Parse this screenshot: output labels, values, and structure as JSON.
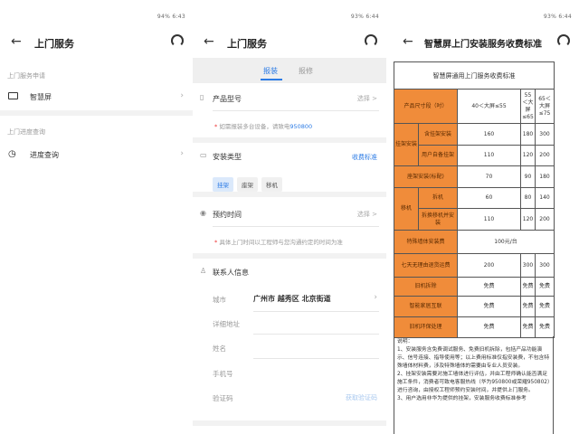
{
  "panel1": {
    "status": "94% 6:43",
    "title": "上门服务",
    "section1": "上门服务申请",
    "item1": "智慧屏",
    "section2": "上门进度查询",
    "item2": "进度查询"
  },
  "panel2": {
    "status": "93% 6:44",
    "title": "上门服务",
    "tabs": [
      "报装",
      "报修"
    ],
    "product": {
      "label": "产品型号",
      "action": "选择 >",
      "note_prefix": "* ",
      "note": "如需报装多台设备，请致电",
      "phone": "950800"
    },
    "install_type": {
      "label": "安装类型",
      "link": "收费标准",
      "chips": [
        "挂架",
        "座架",
        "移机"
      ]
    },
    "appointment": {
      "label": "预约时间",
      "action": "选择 >",
      "note_prefix": "* ",
      "note": "具体上门时间以工程师与您沟通约定的时间为准"
    },
    "contact": {
      "label": "联系人信息",
      "city_label": "城市",
      "city_value": "广州市 越秀区 北京街道",
      "address_label": "详细地址",
      "name_label": "姓名",
      "phone_label": "手机号",
      "code_label": "验证码",
      "code_button": "获取验证码"
    }
  },
  "panel3": {
    "status": "93% 6:44",
    "title": "智慧屏上门安装服务收费标准",
    "table": {
      "title": "智慧屏通用上门服务收费标准",
      "size_label": "产品尺寸段（吋）",
      "sizes": [
        "40＜大屏≤55",
        "55＜大屏≤65",
        "65＜大屏≤75"
      ],
      "wall_group": "挂架安装",
      "wall_rows": [
        {
          "label": "含挂架安装",
          "values": [
            "160",
            "180",
            "300"
          ]
        },
        {
          "label": "用户自备挂架",
          "values": [
            "110",
            "120",
            "200"
          ]
        }
      ],
      "stand": {
        "label": "座架安装(标配)",
        "values": [
          "70",
          "90",
          "180"
        ]
      },
      "move_group": "移机",
      "move_rows": [
        {
          "label": "拆机",
          "values": [
            "60",
            "80",
            "140"
          ]
        },
        {
          "label": "拆换移机并安装",
          "values": [
            "110",
            "120",
            "200"
          ]
        }
      ],
      "special": {
        "label": "特殊墙体安装费",
        "value": "100元/台"
      },
      "return": {
        "label": "七天无理由退货运费",
        "values": [
          "200",
          "300",
          "300"
        ]
      },
      "old_removal": {
        "label": "旧机拆除",
        "values": [
          "免费",
          "免费",
          "免费"
        ]
      },
      "smart_home": {
        "label": "智能家居互联",
        "values": [
          "免费",
          "免费",
          "免费"
        ]
      },
      "recycle": {
        "label": "旧机环保处理",
        "values": [
          "免费",
          "免费",
          "免费"
        ]
      }
    },
    "notes": [
      "说明：",
      "1、安装服务含免费调试服务、免费旧机拆除，包括产品功能演示、信号连接、指导使用等；以上费用标准仅指安装费，不包含特殊墙体材料费，涉及特殊墙体的需要由专业人员安装。",
      "2、挂架安装需要对施工墙体进行评估，并由工程师确认能否满足施工条件，消费者可致电客服热线（华为950800或荣耀950802）进行咨询，由授权工程师预约安装时间，并提供上门服务。",
      "3、用户选用非华为提供的挂架，安装服务收费标准参考"
    ]
  }
}
